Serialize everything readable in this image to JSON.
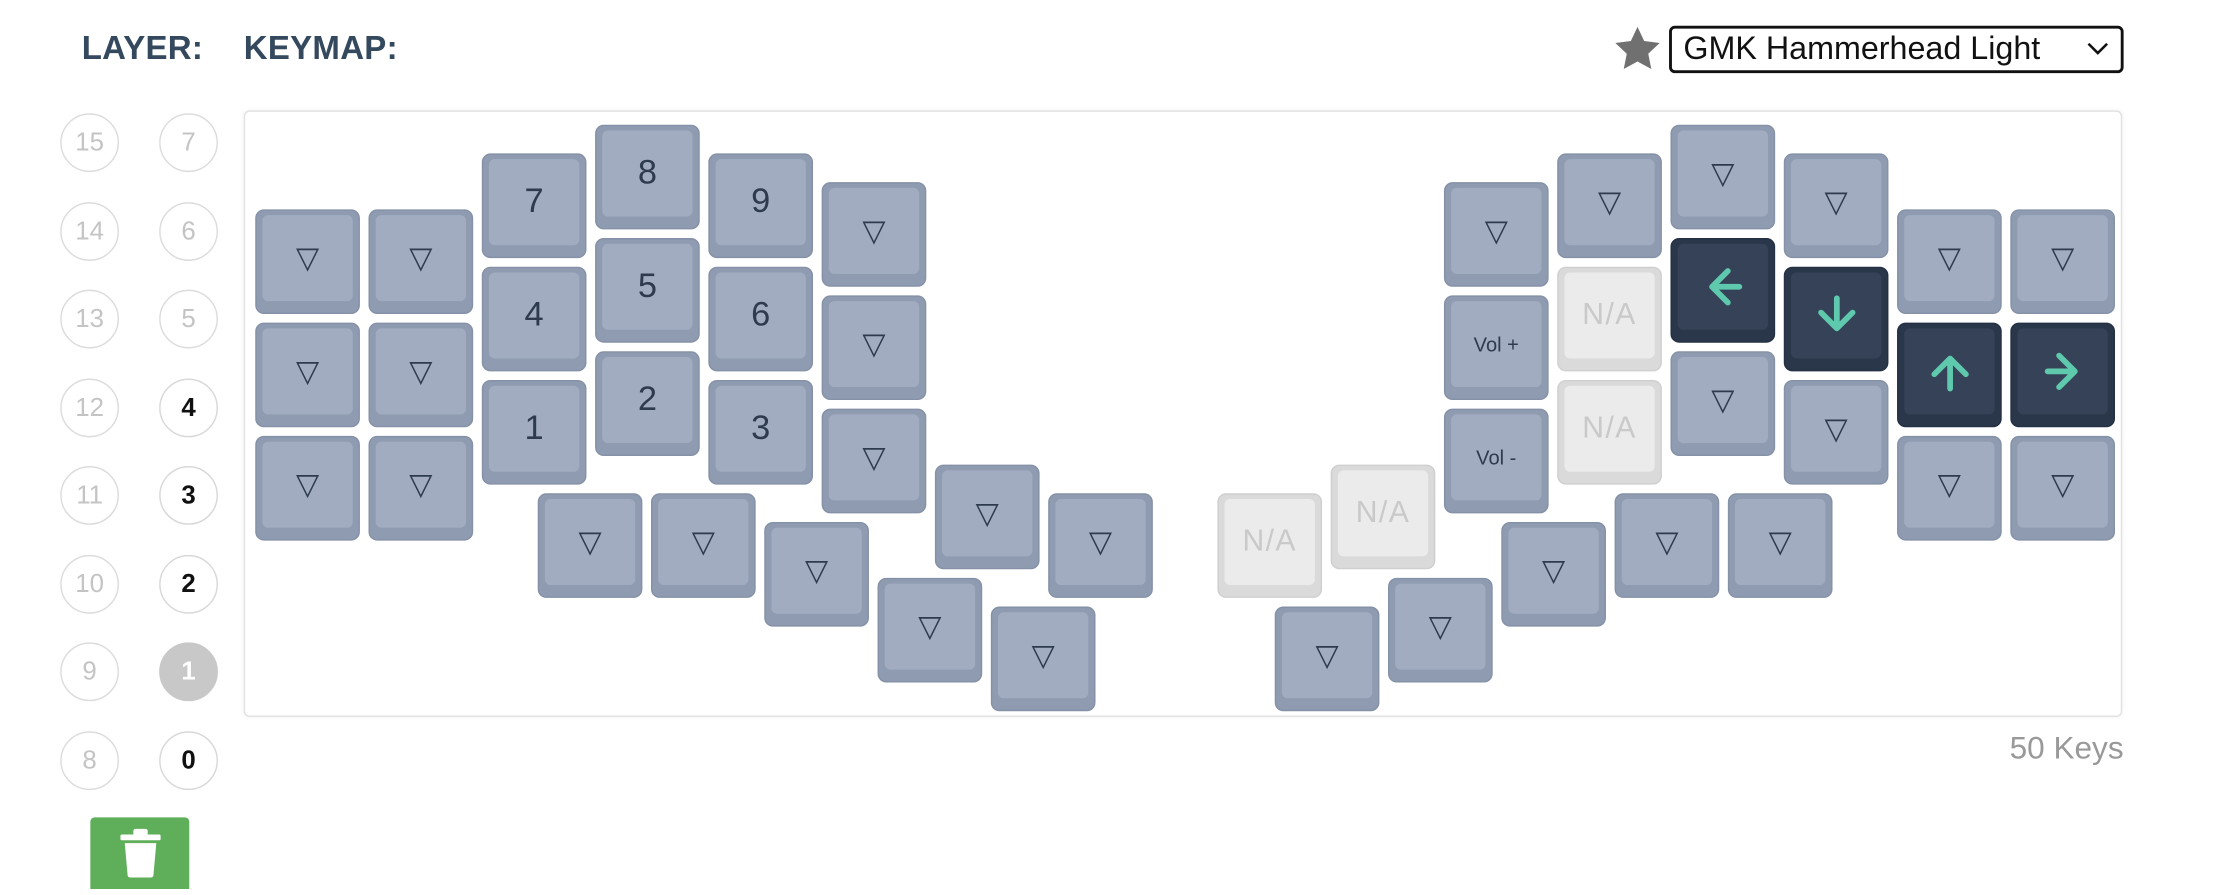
{
  "header": {
    "layer_label": "LAYER:",
    "keymap_label": "KEYMAP:"
  },
  "theme": {
    "selected": "GMK Hammerhead Light",
    "star_icon": "star-icon",
    "chevron_icon": "chevron-down-icon"
  },
  "layers": {
    "left_column": [
      "15",
      "14",
      "13",
      "12",
      "11",
      "10",
      "9",
      "8"
    ],
    "right_column": [
      "7",
      "6",
      "5",
      "4",
      "3",
      "2",
      "1",
      "0"
    ],
    "used": [
      "0",
      "1",
      "2",
      "3",
      "4"
    ],
    "active": "1"
  },
  "trash_button": {
    "icon": "trash-icon"
  },
  "keyboard": {
    "key_count_text": "50 Keys",
    "keys": [
      {
        "label": "▽",
        "style": "normal"
      },
      {
        "label": "▽",
        "style": "normal"
      },
      {
        "label": "7",
        "style": "normal"
      },
      {
        "label": "8",
        "style": "normal"
      },
      {
        "label": "9",
        "style": "normal"
      },
      {
        "label": "▽",
        "style": "normal"
      },
      {
        "label": "▽",
        "style": "normal"
      },
      {
        "label": "▽",
        "style": "normal"
      },
      {
        "label": "4",
        "style": "normal"
      },
      {
        "label": "5",
        "style": "normal"
      },
      {
        "label": "6",
        "style": "normal"
      },
      {
        "label": "▽",
        "style": "normal"
      },
      {
        "label": "▽",
        "style": "normal"
      },
      {
        "label": "▽",
        "style": "normal"
      },
      {
        "label": "1",
        "style": "normal"
      },
      {
        "label": "2",
        "style": "normal"
      },
      {
        "label": "3",
        "style": "normal"
      },
      {
        "label": "▽",
        "style": "normal"
      },
      {
        "label": "▽",
        "style": "normal"
      },
      {
        "label": "▽",
        "style": "normal"
      },
      {
        "label": "▽",
        "style": "normal"
      },
      {
        "label": "▽",
        "style": "normal"
      },
      {
        "label": "▽",
        "style": "normal"
      },
      {
        "label": "▽",
        "style": "normal"
      },
      {
        "label": "▽",
        "style": "normal"
      },
      {
        "label": "▽",
        "style": "normal"
      },
      {
        "label": "▽",
        "style": "normal"
      },
      {
        "label": "▽",
        "style": "normal"
      },
      {
        "label": "▽",
        "style": "normal"
      },
      {
        "label": "▽",
        "style": "normal"
      },
      {
        "label": "▽",
        "style": "normal"
      },
      {
        "label": "Vol +",
        "style": "small"
      },
      {
        "label": "N/A",
        "style": "na"
      },
      {
        "label": "",
        "style": "dark",
        "icon": "arrow-left-icon"
      },
      {
        "label": "",
        "style": "dark",
        "icon": "arrow-down-icon"
      },
      {
        "label": "",
        "style": "dark",
        "icon": "arrow-up-icon"
      },
      {
        "label": "",
        "style": "dark",
        "icon": "arrow-right-icon"
      },
      {
        "label": "Vol -",
        "style": "small"
      },
      {
        "label": "N/A",
        "style": "na"
      },
      {
        "label": "▽",
        "style": "normal"
      },
      {
        "label": "▽",
        "style": "normal"
      },
      {
        "label": "▽",
        "style": "normal"
      },
      {
        "label": "▽",
        "style": "normal"
      },
      {
        "label": "N/A",
        "style": "na"
      },
      {
        "label": "N/A",
        "style": "na"
      },
      {
        "label": "▽",
        "style": "normal"
      },
      {
        "label": "▽",
        "style": "normal"
      },
      {
        "label": "▽",
        "style": "normal"
      },
      {
        "label": "▽",
        "style": "normal"
      },
      {
        "label": "▽",
        "style": "normal"
      },
      {
        "label": "▽",
        "style": "normal"
      },
      {
        "label": "▽",
        "style": "normal"
      }
    ]
  }
}
